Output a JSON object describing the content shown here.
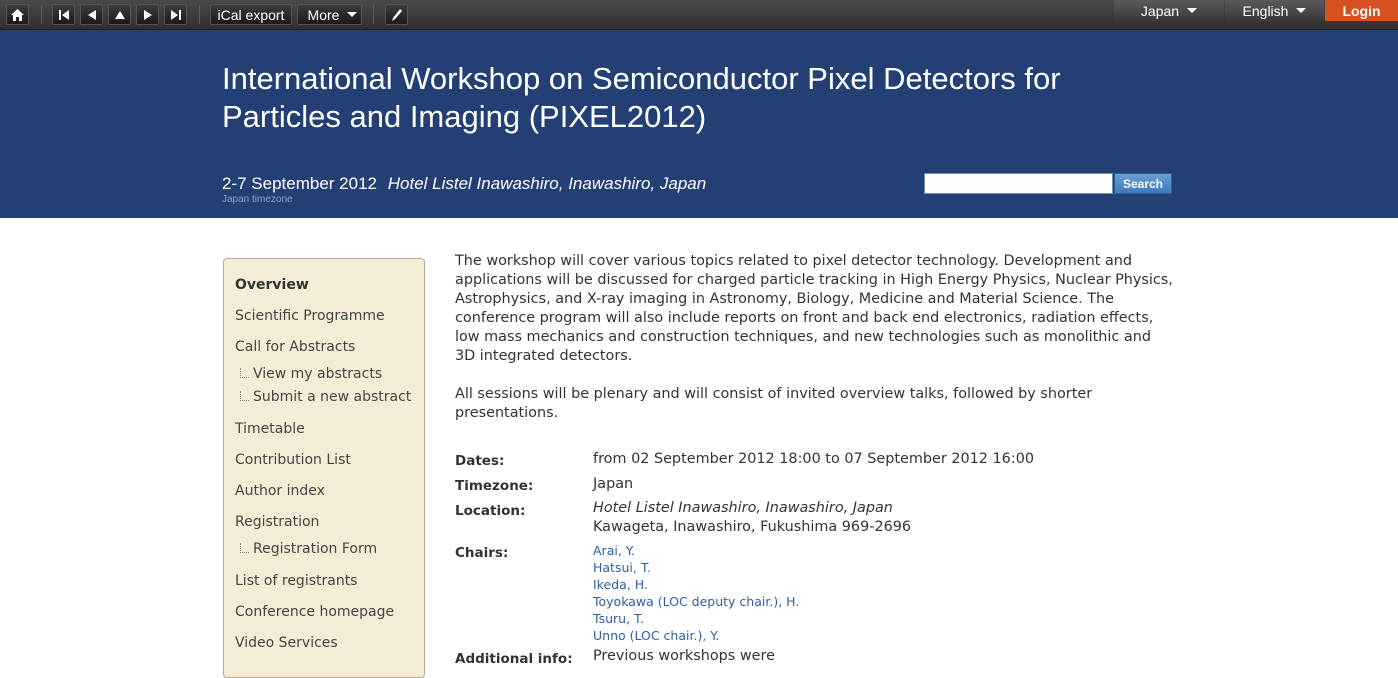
{
  "toolbar": {
    "home_icon": "home-icon",
    "nav_icons": [
      "first-icon",
      "prev-icon",
      "up-icon",
      "next-icon",
      "last-icon"
    ],
    "ical_label": "iCal export",
    "more_label": "More",
    "edit_icon": "pencil-icon",
    "country_label": "Japan",
    "language_label": "English",
    "login_label": "Login"
  },
  "header": {
    "title": "International Workshop on Semiconductor Pixel Detectors for Particles and Imaging (PIXEL2012)",
    "dates": "2-7 September 2012",
    "venue": "Hotel Listel Inawashiro, Inawashiro, Japan",
    "timezone": "Japan timezone",
    "search_button": "Search",
    "search_value": ""
  },
  "sidebar": {
    "items": [
      {
        "label": "Overview",
        "selected": true
      },
      {
        "label": "Scientific Programme"
      },
      {
        "label": "Call for Abstracts"
      },
      {
        "label": "View my abstracts",
        "sub": true
      },
      {
        "label": "Submit a new abstract",
        "sub": true
      },
      {
        "label": "Timetable"
      },
      {
        "label": "Contribution List"
      },
      {
        "label": "Author index"
      },
      {
        "label": "Registration"
      },
      {
        "label": "Registration Form",
        "sub": true
      },
      {
        "label": "List of registrants"
      },
      {
        "label": "Conference homepage"
      },
      {
        "label": "Video Services"
      }
    ]
  },
  "main": {
    "description_1": "The workshop will cover various topics related to pixel detector technology. Development and applications will be discussed for charged particle tracking in High Energy Physics, Nuclear Physics, Astrophysics, and X-ray imaging in Astronomy, Biology, Medicine and Material Science. The conference program will also include reports on front and back end electronics, radiation effects, low mass mechanics and construction techniques, and new technologies such as monolithic and 3D integrated detectors.",
    "description_2": "All sessions will be plenary and will consist of invited overview talks, followed by shorter presentations.",
    "dates_label": "Dates:",
    "dates_value": "from 02 September 2012 18:00 to 07 September 2012 16:00",
    "timezone_label": "Timezone:",
    "timezone_value": "Japan",
    "location_label": "Location:",
    "location_name": "Hotel Listel Inawashiro, Inawashiro, Japan",
    "location_address": "Kawageta, Inawashiro, Fukushima 969-2696",
    "chairs_label": "Chairs:",
    "chairs": [
      "Arai, Y.",
      "Hatsui, T.",
      "Ikeda, H.",
      "Toyokawa (LOC deputy chair.), H.",
      "Tsuru, T.",
      "Unno (LOC chair.), Y."
    ],
    "additional_label": "Additional info:",
    "additional_value": "Previous workshops were"
  },
  "colors": {
    "header_bg": "#233f73",
    "login_bg": "#d8501f",
    "sidebar_bg": "#f5ecd8",
    "link": "#2f5f9e"
  }
}
